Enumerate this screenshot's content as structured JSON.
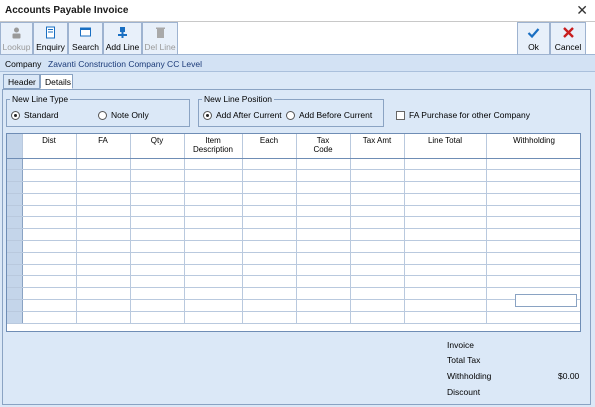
{
  "window": {
    "title": "Accounts Payable Invoice"
  },
  "toolbar": {
    "lookup": "Lookup",
    "enquiry": "Enquiry",
    "search": "Search",
    "add_line": "Add Line",
    "del_line": "Del Line",
    "ok": "Ok",
    "cancel": "Cancel"
  },
  "company": {
    "label": "Company",
    "value": "Zavanti Construction Company CC Level"
  },
  "tabs": {
    "header": "Header",
    "details": "Details"
  },
  "new_line_type": {
    "legend": "New Line Type",
    "standard": "Standard",
    "note_only": "Note Only",
    "selected": "Standard"
  },
  "new_line_position": {
    "legend": "New Line Position",
    "add_after": "Add After Current",
    "add_before": "Add Before Current",
    "selected": "Add After Current"
  },
  "fa_purchase": {
    "label": "FA Purchase for other Company",
    "checked": false
  },
  "grid": {
    "columns": [
      "Dist",
      "FA",
      "Qty",
      "Item Description",
      "Each",
      "Tax\nCode",
      "Tax Amt",
      "Line Total",
      "Withholding"
    ],
    "row_count": 14
  },
  "totals": {
    "invoice_label": "Invoice",
    "total_tax_label": "Total Tax",
    "withholding_label": "Withholding",
    "withholding_value": "$0.00",
    "discount_label": "Discount",
    "discount_value": ""
  },
  "colors": {
    "accent": "#1a6fc2",
    "cancel_red": "#c81e1e",
    "panel": "#dbe8f7"
  }
}
